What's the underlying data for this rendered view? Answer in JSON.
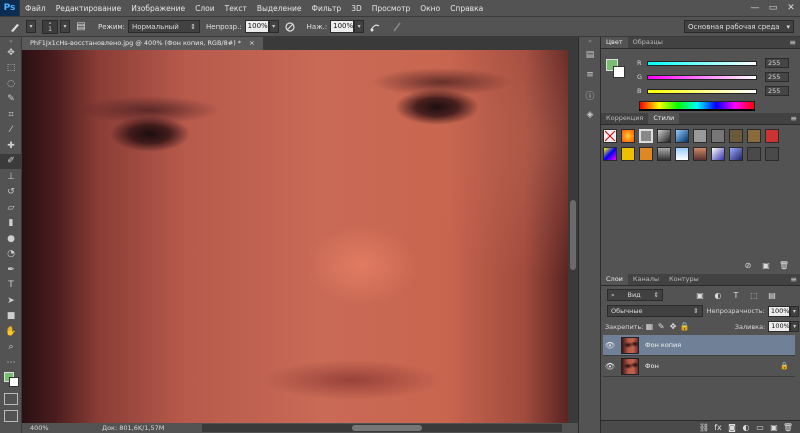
{
  "app": {
    "logo": "Ps"
  },
  "menu": [
    "Файл",
    "Редактирование",
    "Изображение",
    "Слои",
    "Текст",
    "Выделение",
    "Фильтр",
    "3D",
    "Просмотр",
    "Окно",
    "Справка"
  ],
  "window_controls": {
    "minimize": "—",
    "maximize": "▭",
    "close": "✕"
  },
  "options": {
    "brush_size": "1",
    "mode_label": "Режим:",
    "mode_value": "Нормальный",
    "opacity_label": "Непрозр.:",
    "opacity_value": "100%",
    "flow_label": "Наж.:",
    "flow_value": "100%",
    "workspace": "Основная рабочая среда"
  },
  "document": {
    "tab_title": "PhF1Jx1cHs-восстановлено.jpg @ 400% (Фон копия, RGB/8#) *",
    "tab_close": "×",
    "zoom": "400%",
    "doc_info": "Док: 801,6K/1,57M"
  },
  "colors": {
    "foreground": "#7abc72",
    "background": "#ffffff",
    "accent": "#6f8097"
  },
  "color_panel": {
    "tabs": [
      "Цвет",
      "Образцы"
    ],
    "r_label": "R",
    "r_value": "255",
    "g_label": "G",
    "g_value": "255",
    "b_label": "B",
    "b_value": "255"
  },
  "styles_panel": {
    "tabs": [
      "Коррекция",
      "Стили"
    ]
  },
  "layers_panel": {
    "tabs": [
      "Слои",
      "Каналы",
      "Контуры"
    ],
    "filter_kind": "Вид",
    "blend_mode": "Обычные",
    "opacity_label": "Непрозрачность:",
    "opacity_value": "100%",
    "lock_label": "Закрепить:",
    "fill_label": "Заливка:",
    "fill_value": "100%",
    "layers": [
      {
        "name": "Фон копия",
        "selected": true,
        "locked": false
      },
      {
        "name": "Фон",
        "selected": false,
        "locked": true
      }
    ]
  },
  "icons": {
    "brush": "brush-icon",
    "eye": "eye-icon",
    "lock": "lock-icon"
  }
}
